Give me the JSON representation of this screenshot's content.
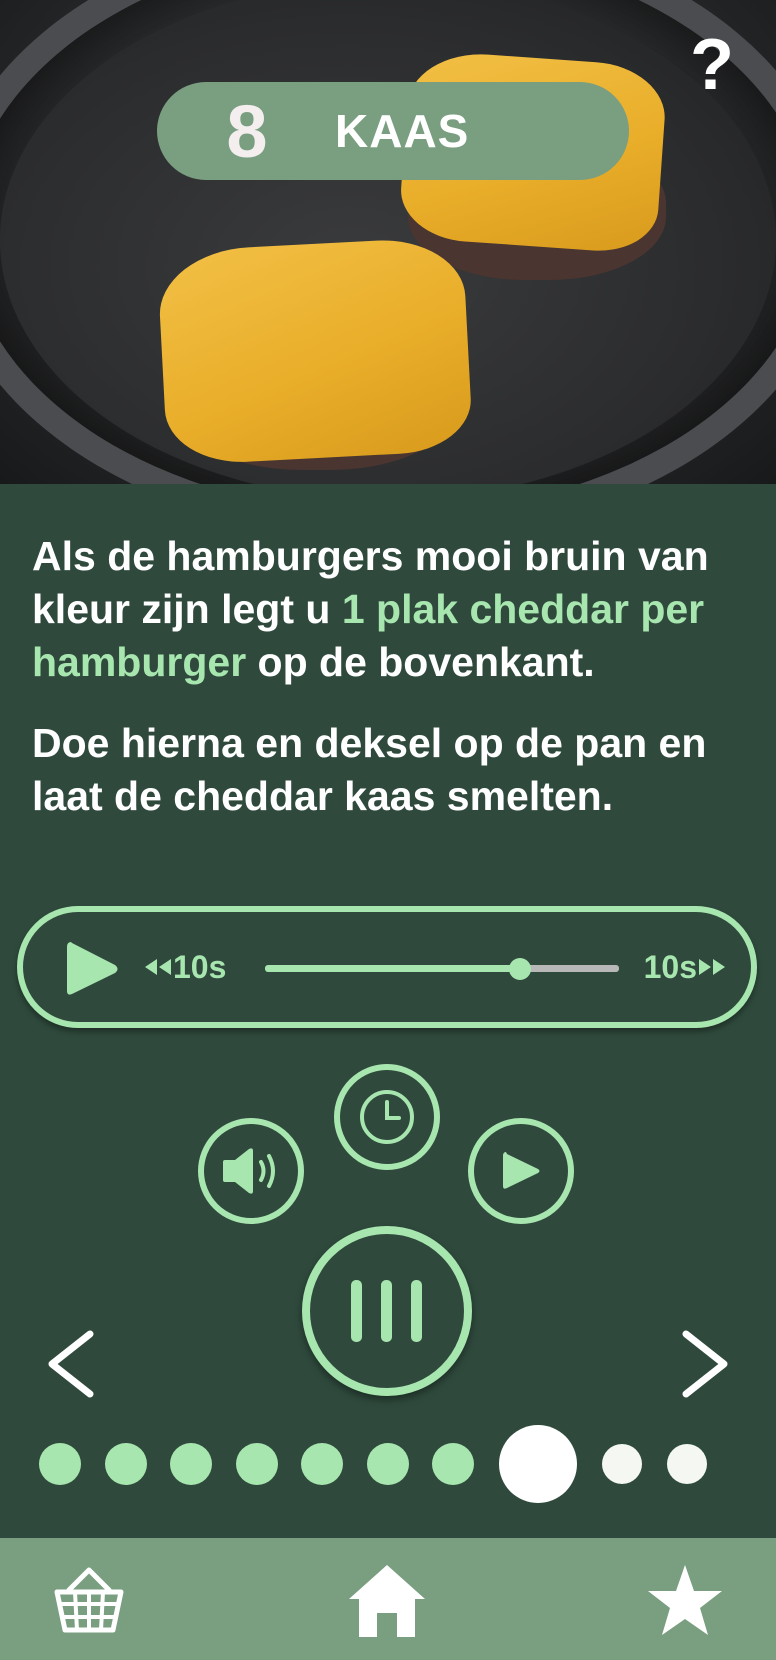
{
  "step": {
    "number": "8",
    "title": "KAAS"
  },
  "help_label": "?",
  "instructions": {
    "p1_a": "Als de hamburgers mooi bruin van kleur zijn legt u ",
    "p1_highlight": "1 plak cheddar per hamburger",
    "p1_b": " op de bovenkant.",
    "p2": "Doe hierna en deksel op de pan en laat de cheddar kaas smelten."
  },
  "audio_player": {
    "rewind_label": "10s",
    "forward_label": "10s",
    "progress": 0.72
  },
  "controls": {
    "timer_icon": "clock-icon",
    "sound_icon": "speaker-icon",
    "video_icon": "play-circle-icon",
    "pause_icon": "pause-icon"
  },
  "pagination": {
    "total": 10,
    "current": 8
  },
  "bottom_nav": {
    "items": [
      "basket-icon",
      "home-icon",
      "star-icon"
    ]
  },
  "colors": {
    "background": "#2f4a3d",
    "accent": "#a8e6af",
    "pill": "#7a9f80",
    "upcoming_dot": "#f4f7f2"
  }
}
